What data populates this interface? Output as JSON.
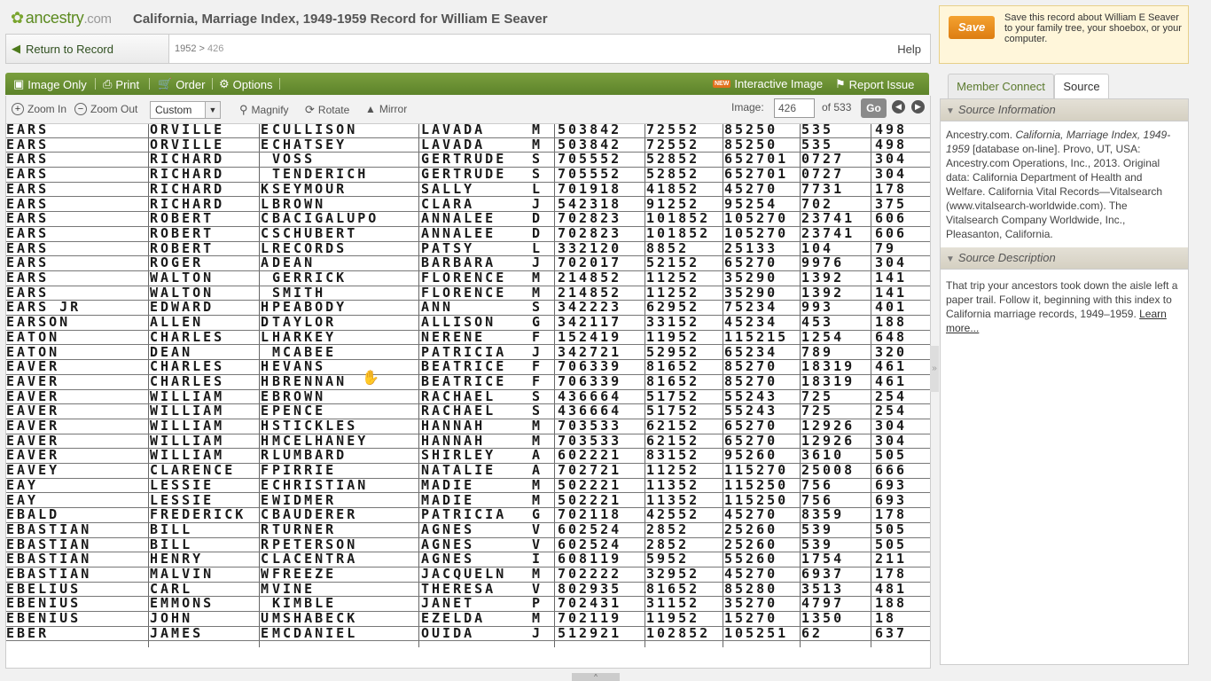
{
  "header": {
    "logo_text": "ancestry",
    "logo_domain": ".com",
    "title": "California, Marriage Index, 1949-1959 Record for William E Seaver"
  },
  "nav": {
    "return_label": "Return to Record",
    "breadcrumb_year": "1952",
    "breadcrumb_sep": ">",
    "breadcrumb_page": "426",
    "help_label": "Help"
  },
  "toolbar": {
    "image_only": "Image Only",
    "print": "Print",
    "order": "Order",
    "options": "Options",
    "interactive_image": "Interactive Image",
    "new_badge": "NEW",
    "report_issue": "Report Issue"
  },
  "subbar": {
    "zoom_in": "Zoom In",
    "zoom_out": "Zoom Out",
    "zoom_value": "Custom",
    "magnify": "Magnify",
    "rotate": "Rotate",
    "mirror": "Mirror",
    "image_label": "Image:",
    "image_number": "426",
    "image_of": "of 533",
    "go": "Go"
  },
  "records": [
    [
      "EARS",
      "ORVILLE",
      "E",
      "CULLISON",
      "LAVADA",
      "M",
      "503842",
      "72552",
      "85250",
      "535",
      "498"
    ],
    [
      "EARS",
      "ORVILLE",
      "E",
      "CHATSEY",
      "LAVADA",
      "M",
      "503842",
      "72552",
      "85250",
      "535",
      "498"
    ],
    [
      "EARS",
      "RICHARD",
      "",
      "VOSS",
      "GERTRUDE",
      "S",
      "705552",
      "52852",
      "652701",
      "0727",
      "304"
    ],
    [
      "EARS",
      "RICHARD",
      "",
      "TENDERICH",
      "GERTRUDE",
      "S",
      "705552",
      "52852",
      "652701",
      "0727",
      "304"
    ],
    [
      "EARS",
      "RICHARD",
      "K",
      "SEYMOUR",
      "SALLY",
      "L",
      "701918",
      "41852",
      "45270",
      "7731",
      "178"
    ],
    [
      "EARS",
      "RICHARD",
      "L",
      "BROWN",
      "CLARA",
      "J",
      "542318",
      "91252",
      "95254",
      "702",
      "375"
    ],
    [
      "EARS",
      "ROBERT",
      "C",
      "BACIGALUPO",
      "ANNALEE",
      "D",
      "702823",
      "101852",
      "105270",
      "23741",
      "606"
    ],
    [
      "EARS",
      "ROBERT",
      "C",
      "SCHUBERT",
      "ANNALEE",
      "D",
      "702823",
      "101852",
      "105270",
      "23741",
      "606"
    ],
    [
      "EARS",
      "ROBERT",
      "L",
      "RECORDS",
      "PATSY",
      "L",
      "332120",
      "8852",
      "25133",
      "104",
      "79"
    ],
    [
      "EARS",
      "ROGER",
      "A",
      "DEAN",
      "BARBARA",
      "J",
      "702017",
      "52152",
      "65270",
      "9976",
      "304"
    ],
    [
      "EARS",
      "WALTON",
      "",
      "GERRICK",
      "FLORENCE",
      "M",
      "214852",
      "11252",
      "35290",
      "1392",
      "141"
    ],
    [
      "EARS",
      "WALTON",
      "",
      "SMITH",
      "FLORENCE",
      "M",
      "214852",
      "11252",
      "35290",
      "1392",
      "141"
    ],
    [
      "EARS JR",
      "EDWARD",
      "H",
      "PEABODY",
      "ANN",
      "S",
      "342223",
      "62952",
      "75234",
      "993",
      "401"
    ],
    [
      "EARSON",
      "ALLEN",
      "D",
      "TAYLOR",
      "ALLISON",
      "G",
      "342117",
      "33152",
      "45234",
      "453",
      "188"
    ],
    [
      "EATON",
      "CHARLES",
      "L",
      "HARKEY",
      "NERENE",
      "F",
      "152419",
      "11952",
      "115215",
      "1254",
      "648"
    ],
    [
      "EATON",
      "DEAN",
      "",
      "MCABEE",
      "PATRICIA",
      "J",
      "342721",
      "52952",
      "65234",
      "789",
      "320"
    ],
    [
      "EAVER",
      "CHARLES",
      "H",
      "EVANS",
      "BEATRICE",
      "F",
      "706339",
      "81652",
      "85270",
      "18319",
      "461"
    ],
    [
      "EAVER",
      "CHARLES",
      "H",
      "BRENNAN",
      "BEATRICE",
      "F",
      "706339",
      "81652",
      "85270",
      "18319",
      "461"
    ],
    [
      "EAVER",
      "WILLIAM",
      "E",
      "BROWN",
      "RACHAEL",
      "S",
      "436664",
      "51752",
      "55243",
      "725",
      "254"
    ],
    [
      "EAVER",
      "WILLIAM",
      "E",
      "PENCE",
      "RACHAEL",
      "S",
      "436664",
      "51752",
      "55243",
      "725",
      "254"
    ],
    [
      "EAVER",
      "WILLIAM",
      "H",
      "STICKLES",
      "HANNAH",
      "M",
      "703533",
      "62152",
      "65270",
      "12926",
      "304"
    ],
    [
      "EAVER",
      "WILLIAM",
      "H",
      "MCELHANEY",
      "HANNAH",
      "M",
      "703533",
      "62152",
      "65270",
      "12926",
      "304"
    ],
    [
      "EAVER",
      "WILLIAM",
      "R",
      "LUMBARD",
      "SHIRLEY",
      "A",
      "602221",
      "83152",
      "95260",
      "3610",
      "505"
    ],
    [
      "EAVEY",
      "CLARENCE",
      "F",
      "PIRRIE",
      "NATALIE",
      "A",
      "702721",
      "11252",
      "115270",
      "25008",
      "666"
    ],
    [
      "EAY",
      "LESSIE",
      "E",
      "CHRISTIAN",
      "MADIE",
      "M",
      "502221",
      "11352",
      "115250",
      "756",
      "693"
    ],
    [
      "EAY",
      "LESSIE",
      "E",
      "WIDMER",
      "MADIE",
      "M",
      "502221",
      "11352",
      "115250",
      "756",
      "693"
    ],
    [
      "EBALD",
      "FREDERICK",
      "C",
      "BAUDERER",
      "PATRICIA",
      "G",
      "702118",
      "42552",
      "45270",
      "8359",
      "178"
    ],
    [
      "EBASTIAN",
      "BILL",
      "R",
      "TURNER",
      "AGNES",
      "V",
      "602524",
      "2852",
      "25260",
      "539",
      "505"
    ],
    [
      "EBASTIAN",
      "BILL",
      "R",
      "PETERSON",
      "AGNES",
      "V",
      "602524",
      "2852",
      "25260",
      "539",
      "505"
    ],
    [
      "EBASTIAN",
      "HENRY",
      "C",
      "LACENTRA",
      "AGNES",
      "I",
      "608119",
      "5952",
      "55260",
      "1754",
      "211"
    ],
    [
      "EBASTIAN",
      "MALVIN",
      "W",
      "FREEZE",
      "JACQUELN",
      "M",
      "702222",
      "32952",
      "45270",
      "6937",
      "178"
    ],
    [
      "EBELIUS",
      "CARL",
      "M",
      "VINE",
      "THERESA",
      "V",
      "802935",
      "81652",
      "85280",
      "3513",
      "481"
    ],
    [
      "EBENIUS",
      "EMMONS",
      "",
      "KIMBLE",
      "JANET",
      "P",
      "702431",
      "31152",
      "35270",
      "4797",
      "188"
    ],
    [
      "EBENIUS",
      "JOHN",
      "U",
      "MSHABECK",
      "EZELDA",
      "M",
      "702119",
      "11952",
      "15270",
      "1350",
      "18"
    ],
    [
      "EBER",
      "JAMES",
      "E",
      "MCDANIEL",
      "OUIDA",
      "J",
      "512921",
      "102852",
      "105251",
      "62",
      "637"
    ]
  ],
  "right_panel": {
    "save_button": "Save",
    "save_text": "Save this record about William E Seaver to your family tree, your shoebox, or your computer.",
    "tab_member_connect": "Member Connect",
    "tab_source": "Source",
    "source_info_title": "Source Information",
    "source_info_pre": "Ancestry.com. ",
    "source_info_italic": "California, Marriage Index, 1949-1959",
    "source_info_post": " [database on-line]. Provo, UT, USA: Ancestry.com Operations, Inc., 2013. Original data: California Department of Health and Welfare. California Vital Records—Vitalsearch (www.vitalsearch-worldwide.com). The Vitalsearch Company Worldwide, Inc., Pleasanton, California.",
    "source_desc_title": "Source Description",
    "source_desc_text": "That trip your ancestors took down the aisle left a paper trail. Follow it, beginning with this index to California marriage records, 1949–1959. ",
    "learn_more": "Learn more..."
  }
}
